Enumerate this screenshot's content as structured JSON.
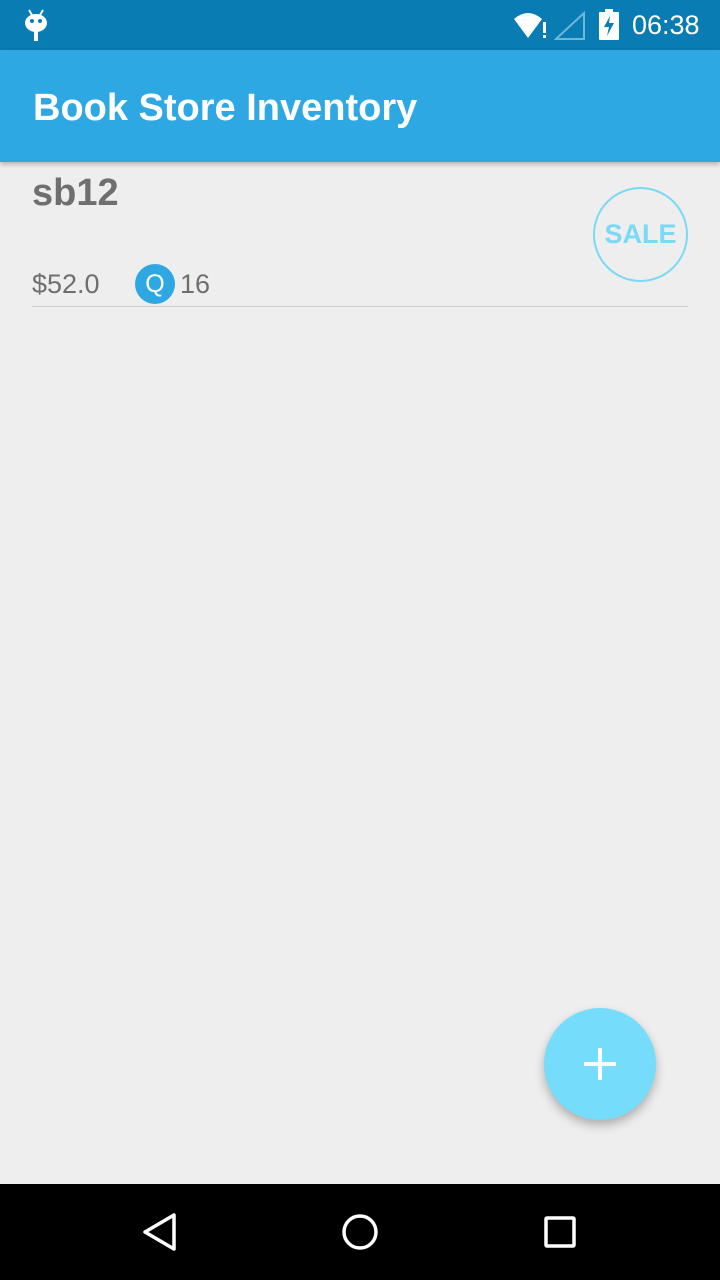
{
  "status_bar": {
    "time": "06:38",
    "icons": [
      "android-icon",
      "wifi-icon",
      "signal-icon",
      "battery-charging-icon"
    ]
  },
  "app_bar": {
    "title": "Book Store Inventory",
    "color": "#2ea8e3"
  },
  "items": [
    {
      "name": "sb12",
      "price": "$52.0",
      "quantity_badge": "Q",
      "quantity": "16",
      "sale_label": "SALE"
    }
  ],
  "fab": {
    "icon": "plus-icon",
    "color": "#76dcfb"
  },
  "nav_bar": {
    "icons": [
      "back-icon",
      "home-icon",
      "recents-icon"
    ]
  },
  "colors": {
    "status_bar": "#0a7cb4",
    "background": "#eeeeee",
    "accent": "#76dcfb"
  }
}
